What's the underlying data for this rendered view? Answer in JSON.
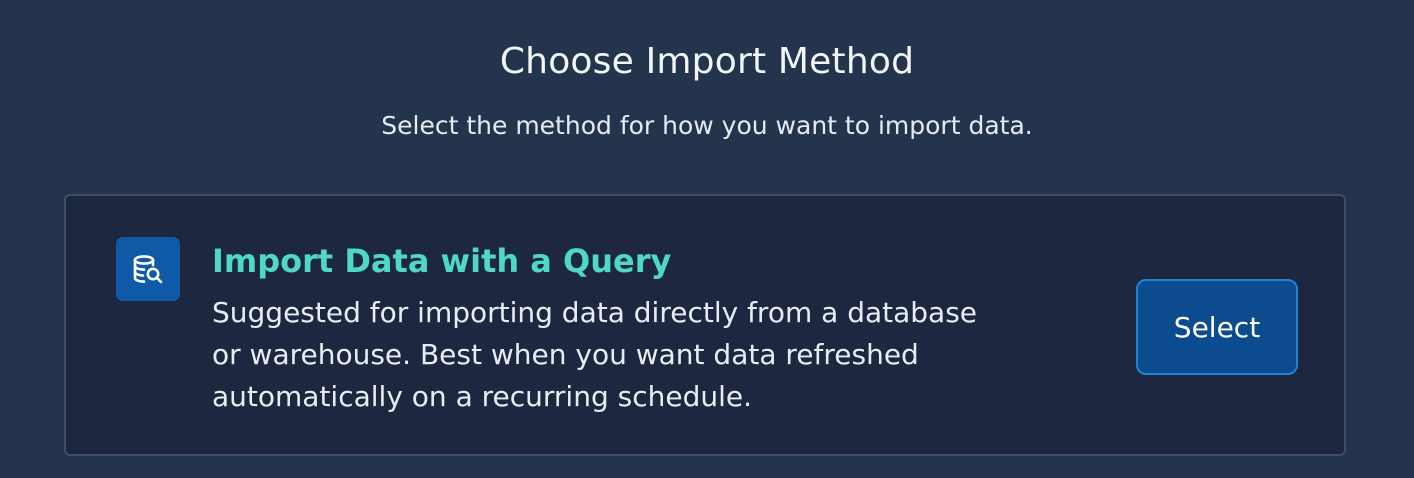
{
  "header": {
    "title": "Choose Import Method",
    "subtitle": "Select the method for how you want to import data."
  },
  "options": [
    {
      "icon": "database-search-icon",
      "title": "Import Data with a Query",
      "description_lines": [
        "Suggested for importing data directly from a database",
        "or warehouse. Best when you want data refreshed",
        "automatically on a recurring schedule."
      ],
      "button_label": "Select"
    }
  ],
  "colors": {
    "background": "#25344d",
    "card_background": "#1d2840",
    "card_border": "#3e4e69",
    "accent_title": "#4ed8c5",
    "icon_background": "#0f5aa6",
    "button_background": "#0d4b8f",
    "button_border": "#1f83d3"
  }
}
